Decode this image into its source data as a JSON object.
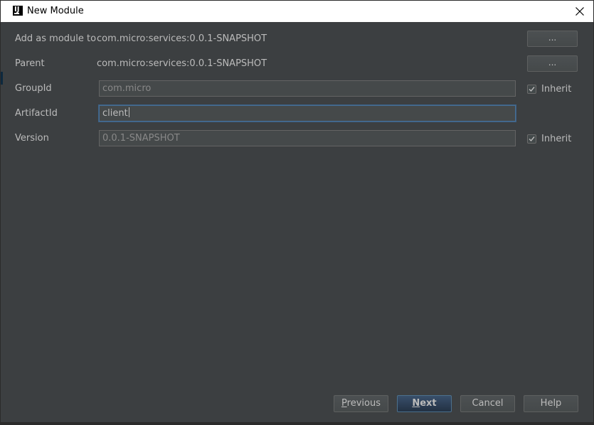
{
  "window": {
    "title": "New Module",
    "icon": "intellij-app-icon",
    "close_icon": "close-icon"
  },
  "form": {
    "add_as_module": {
      "label": "Add as module to",
      "value": "com.micro:services:0.0.1-SNAPSHOT",
      "button_label": "..."
    },
    "parent": {
      "label": "Parent",
      "value": "com.micro:services:0.0.1-SNAPSHOT",
      "button_label": "..."
    },
    "group_id": {
      "label": "GroupId",
      "value": "com.micro",
      "inherit_label": "Inherit",
      "inherit_checked": true
    },
    "artifact_id": {
      "label": "ArtifactId",
      "value": "client"
    },
    "version": {
      "label": "Version",
      "value": "0.0.1-SNAPSHOT",
      "inherit_label": "Inherit",
      "inherit_checked": true
    }
  },
  "footer": {
    "previous": {
      "label": "Previous",
      "mnemonic": "P",
      "rest": "revious"
    },
    "next": {
      "label": "Next",
      "mnemonic": "N",
      "rest": "ext"
    },
    "cancel": {
      "label": "Cancel"
    },
    "help": {
      "label": "Help"
    }
  },
  "colors": {
    "background": "#3c3f41",
    "field_background": "#45494a",
    "focus_border": "#466d94",
    "primary_button": "#365880",
    "text": "#bbbbbb"
  }
}
